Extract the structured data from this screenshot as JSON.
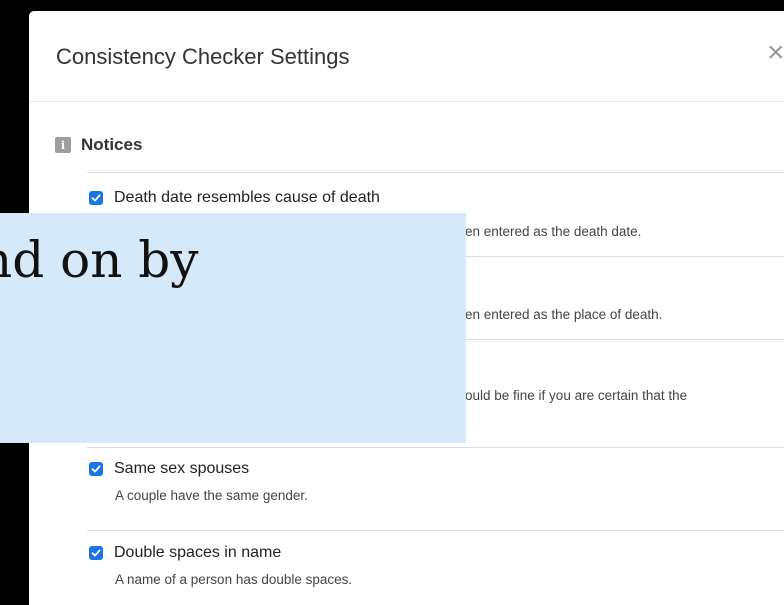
{
  "dialog": {
    "title": "Consistency Checker Settings",
    "close_label": "×"
  },
  "section": {
    "icon_letter": "i",
    "title": "Notices"
  },
  "items": [
    {
      "label": "Death date resembles cause of death",
      "desc_visible": "en entered as the death date.",
      "checked": true
    },
    {
      "label": "",
      "desc_visible": "en entered as the place of death.",
      "checked": true
    },
    {
      "label": "",
      "desc_visible": "ould be fine if you are certain that the",
      "checked": true
    },
    {
      "label": "Same sex spouses",
      "desc": "A couple have the same gender.",
      "checked": true
    },
    {
      "label": "Double spaces in name",
      "desc": "A name of a person has double spaces.",
      "checked": true
    }
  ],
  "overlay": {
    "text": "nd on by"
  },
  "colors": {
    "checkbox": "#1a73e8",
    "overlay_bg": "#d6e9f8",
    "frame": "#000000"
  }
}
